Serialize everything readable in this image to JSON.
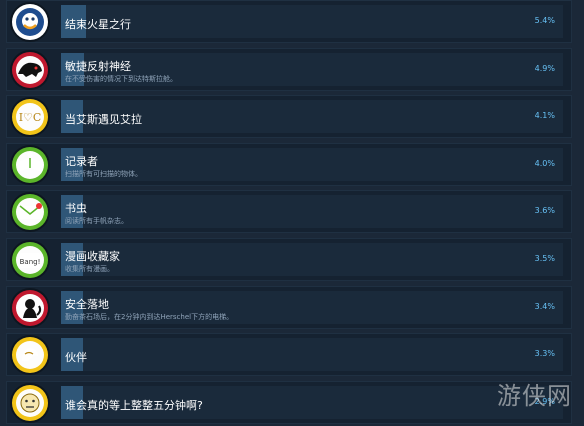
{
  "achievements": [
    {
      "name": "结束火星之行",
      "desc": "",
      "percent": "5.4%",
      "fill": 0.054,
      "icon": "duck-icon",
      "accent": "#ffffff"
    },
    {
      "name": "敏捷反射神经",
      "desc": "在不受伤害的情况下到达特斯拉舱。",
      "percent": "4.9%",
      "fill": 0.049,
      "icon": "creature-icon",
      "accent": "#c0182e"
    },
    {
      "name": "当艾斯遇见艾拉",
      "desc": "",
      "percent": "4.1%",
      "fill": 0.041,
      "icon": "hearts-icon",
      "accent": "#f2c419"
    },
    {
      "name": "记录者",
      "desc": "扫描所有可扫描的物体。",
      "percent": "4.0%",
      "fill": 0.04,
      "icon": "book-icon",
      "accent": "#5bb52a"
    },
    {
      "name": "书虫",
      "desc": "阅读所有手帆杂志。",
      "percent": "3.6%",
      "fill": 0.036,
      "icon": "mail-icon",
      "accent": "#5bb52a"
    },
    {
      "name": "漫画收藏家",
      "desc": "收集所有漫画。",
      "percent": "3.5%",
      "fill": 0.035,
      "icon": "comic-icon",
      "accent": "#5bb52a"
    },
    {
      "name": "安全落地",
      "desc": "勤奋茶石场后，在2分钟内到达Herschel下方的电梯。",
      "percent": "3.4%",
      "fill": 0.034,
      "icon": "monkey-icon",
      "accent": "#c0182e"
    },
    {
      "name": "伙伴",
      "desc": "",
      "percent": "3.3%",
      "fill": 0.033,
      "icon": "hand-icon",
      "accent": "#f2c419"
    },
    {
      "name": "谁会真的等上整整五分钟啊?",
      "desc": "",
      "percent": "2.9%",
      "fill": 0.029,
      "icon": "face-icon",
      "accent": "#f2c419"
    }
  ],
  "watermark": "游侠网"
}
